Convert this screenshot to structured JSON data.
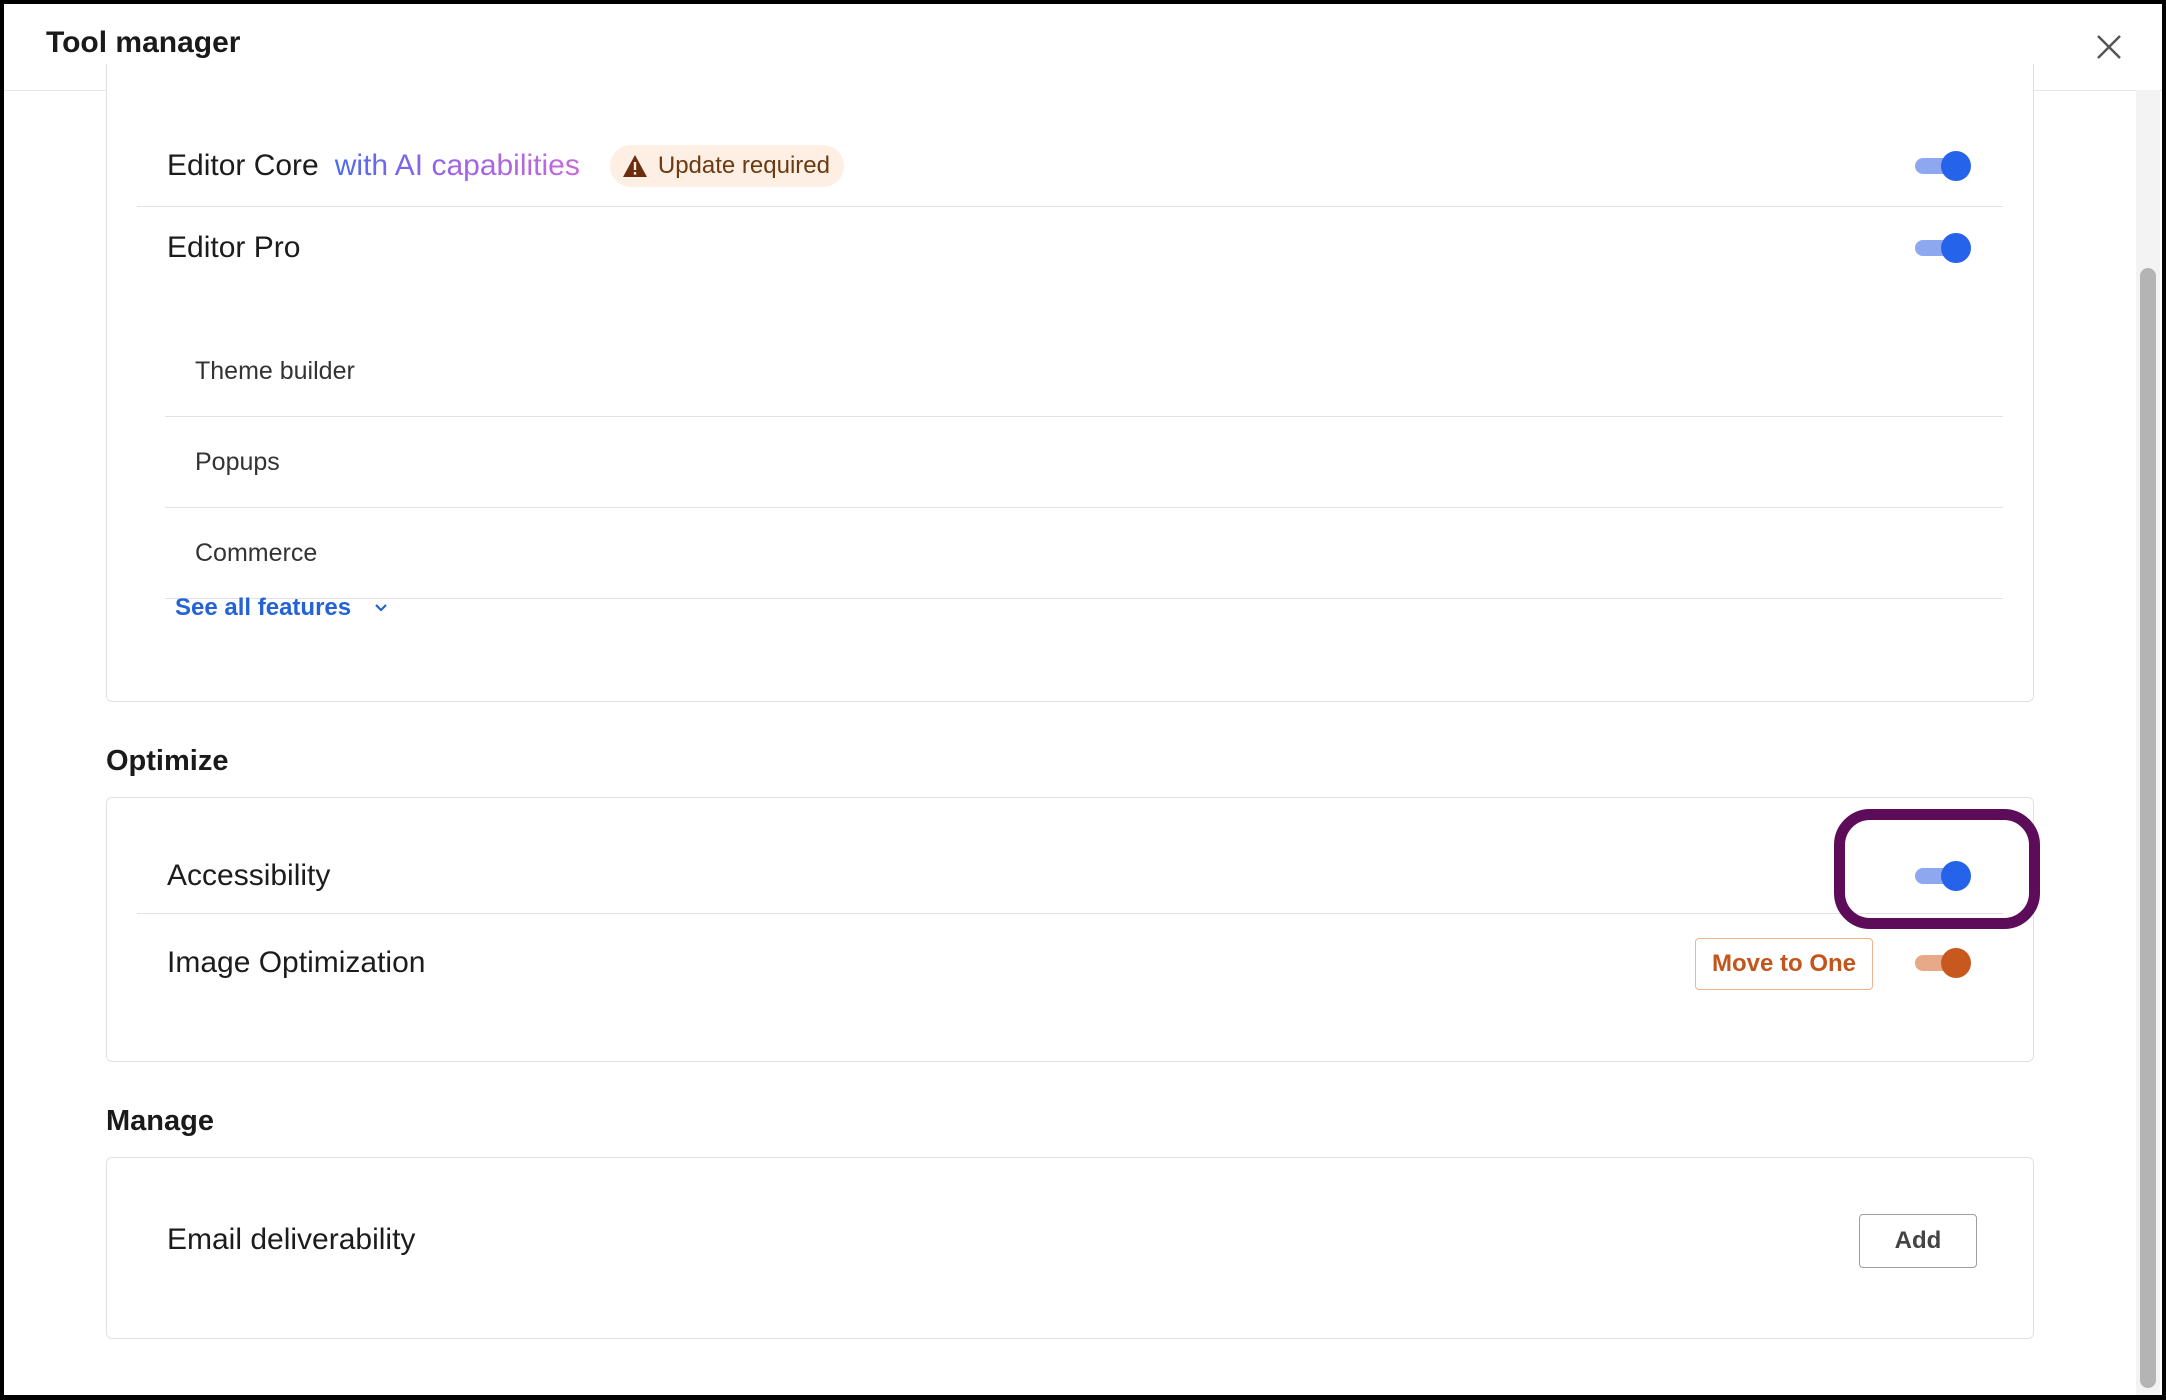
{
  "header": {
    "title": "Tool manager",
    "close_icon": "close-icon"
  },
  "top_card": {
    "editor_core": {
      "label": "Editor Core",
      "ai_label": "with AI capabilities",
      "badge": "Update required",
      "badge_icon": "warning-icon",
      "enabled": true
    },
    "editor_pro": {
      "label": "Editor Pro",
      "enabled": true,
      "features": [
        "Theme builder",
        "Popups",
        "Commerce"
      ]
    },
    "see_all": "See all features"
  },
  "optimize": {
    "heading": "Optimize",
    "accessibility": {
      "label": "Accessibility",
      "enabled": true
    },
    "image_optimization": {
      "label": "Image Optimization",
      "button": "Move to One",
      "enabled": true
    }
  },
  "manage": {
    "heading": "Manage",
    "email": {
      "label": "Email deliverability",
      "button": "Add"
    }
  },
  "colors": {
    "accent": "#2563eb",
    "orange": "#c7591f",
    "highlight": "#5d0c5a"
  }
}
